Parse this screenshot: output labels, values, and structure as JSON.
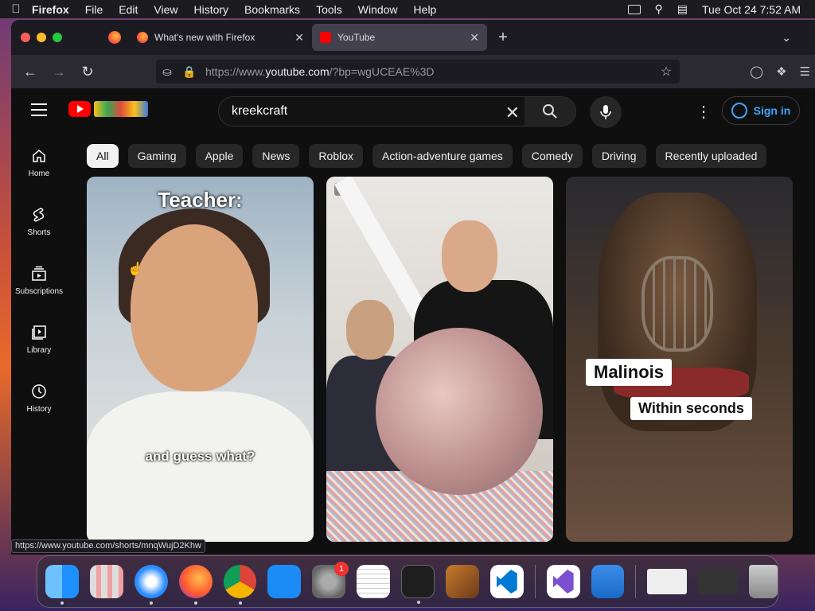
{
  "menubar": {
    "apple_icon": "apple-icon",
    "app_name": "Firefox",
    "items": [
      "File",
      "Edit",
      "View",
      "History",
      "Bookmarks",
      "Tools",
      "Window",
      "Help"
    ],
    "datetime": "Tue Oct 24  7:52 AM"
  },
  "browser": {
    "tabs": [
      {
        "label": "What's new with Firefox",
        "favicon": "firefox-icon"
      },
      {
        "label": "YouTube",
        "favicon": "youtube-icon",
        "active": true
      }
    ],
    "url_prefix": "https://www.",
    "url_domain": "youtube.com",
    "url_suffix": "/?bp=wgUCEAE%3D",
    "status_url": "https://www.youtube.com/shorts/mnqWujD2Khw"
  },
  "youtube": {
    "search_query": "kreekcraft",
    "sign_in_label": "Sign in",
    "sidebar": [
      {
        "label": "Home",
        "icon": "home-icon"
      },
      {
        "label": "Shorts",
        "icon": "shorts-icon"
      },
      {
        "label": "Subscriptions",
        "icon": "subscriptions-icon"
      },
      {
        "label": "Library",
        "icon": "library-icon"
      },
      {
        "label": "History",
        "icon": "history-icon"
      }
    ],
    "chips": [
      "All",
      "Gaming",
      "Apple",
      "News",
      "Roblox",
      "Action-adventure games",
      "Comedy",
      "Driving",
      "Recently uploaded"
    ],
    "active_chip": "All",
    "shorts": [
      {
        "title_overlay": "Teacher:",
        "caption_overlay": "and guess what?"
      },
      {
        "title_overlay": "",
        "caption_overlay": ""
      },
      {
        "label_1": "Malinois",
        "label_2": "Within seconds"
      }
    ]
  },
  "dock": {
    "apps": [
      "Finder",
      "Launchpad",
      "Safari",
      "Firefox",
      "Chrome",
      "App Store",
      "System Settings",
      "TextEdit",
      "Terminal",
      "GarageBand",
      "Visual Studio Code",
      "Visual Studio",
      "Weather",
      "Preview",
      "Google Chrome Window",
      "Trash"
    ],
    "settings_badge": "1"
  },
  "colors": {
    "yt_red": "#ff0000",
    "sign_in_blue": "#3ea6ff",
    "yt_bg": "#0f0f0f"
  }
}
